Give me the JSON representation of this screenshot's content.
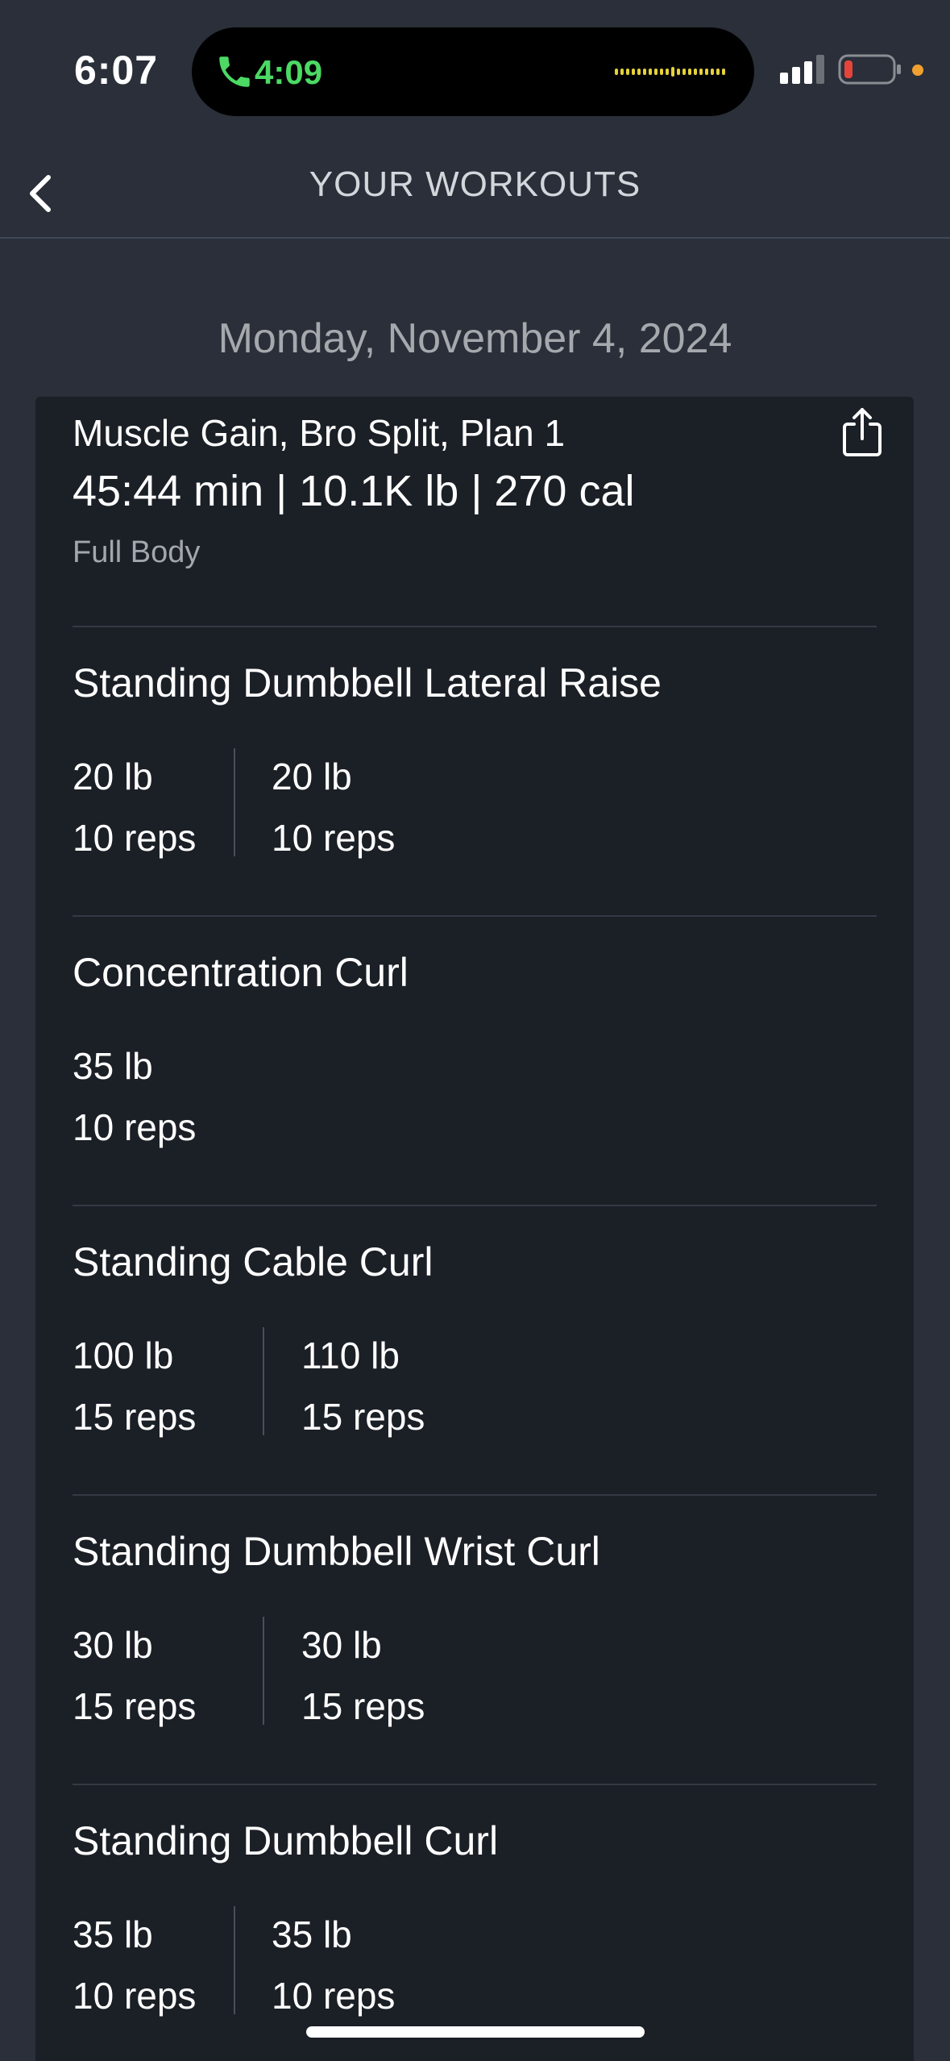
{
  "status_bar": {
    "time": "6:07",
    "call_time": "4:09",
    "call_color": "#4cd964",
    "battery_color": "#e5443a",
    "privacy_dot_color": "#f0a030"
  },
  "header": {
    "title": "YOUR WORKOUTS",
    "back_icon": "chevron-left-icon"
  },
  "date": "Monday, November 4, 2024",
  "workout": {
    "plan_name": "Muscle Gain, Bro Split, Plan 1",
    "summary": "45:44 min | 10.1K lb | 270 cal",
    "category": "Full Body",
    "share_icon": "share-icon",
    "exercises": [
      {
        "name": "Standing Dumbbell Lateral Raise",
        "sets": [
          {
            "weight": "20 lb",
            "reps": "10 reps"
          },
          {
            "weight": "20 lb",
            "reps": "10 reps"
          }
        ]
      },
      {
        "name": "Concentration Curl",
        "sets": [
          {
            "weight": "35 lb",
            "reps": "10 reps"
          }
        ]
      },
      {
        "name": "Standing Cable Curl",
        "sets": [
          {
            "weight": "100 lb",
            "reps": "15 reps"
          },
          {
            "weight": "110 lb",
            "reps": "15 reps"
          }
        ]
      },
      {
        "name": "Standing Dumbbell Wrist Curl",
        "sets": [
          {
            "weight": "30 lb",
            "reps": "15 reps"
          },
          {
            "weight": "30 lb",
            "reps": "15 reps"
          }
        ]
      },
      {
        "name": "Standing Dumbbell Curl",
        "sets": [
          {
            "weight": "35 lb",
            "reps": "10 reps"
          },
          {
            "weight": "35 lb",
            "reps": "10 reps"
          }
        ]
      }
    ]
  }
}
